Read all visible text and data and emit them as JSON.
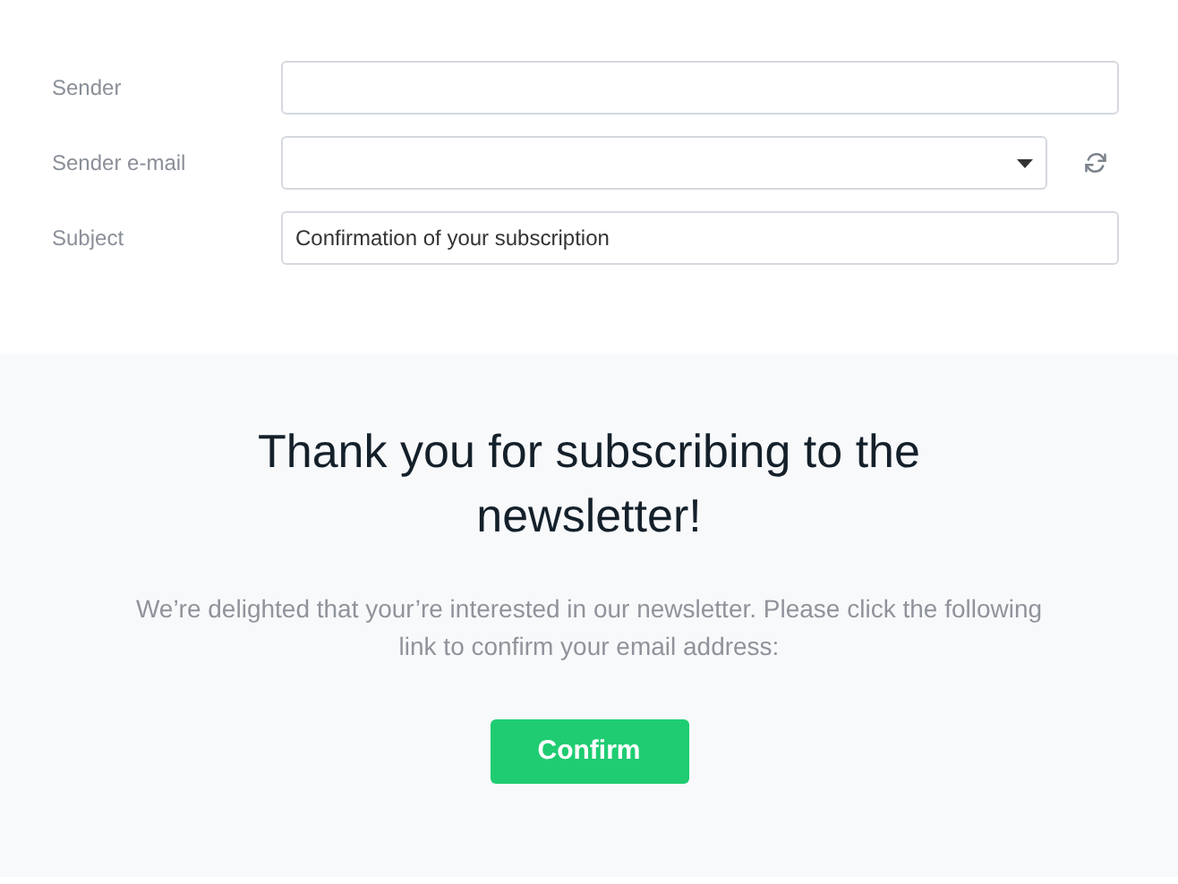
{
  "fields": [
    {
      "label": "Sender",
      "kind": "text"
    },
    {
      "label": "Sender e-mail",
      "kind": "select"
    },
    {
      "label": "Subject",
      "kind": "text",
      "value": "Confirmation of your subscription"
    }
  ],
  "preview": {
    "heading": "Thank you for subscribing to the newsletter!",
    "body": "We’re delighted that your’re interested in our newsletter. Please click the following link to confirm your email address:",
    "button": "Confirm"
  }
}
